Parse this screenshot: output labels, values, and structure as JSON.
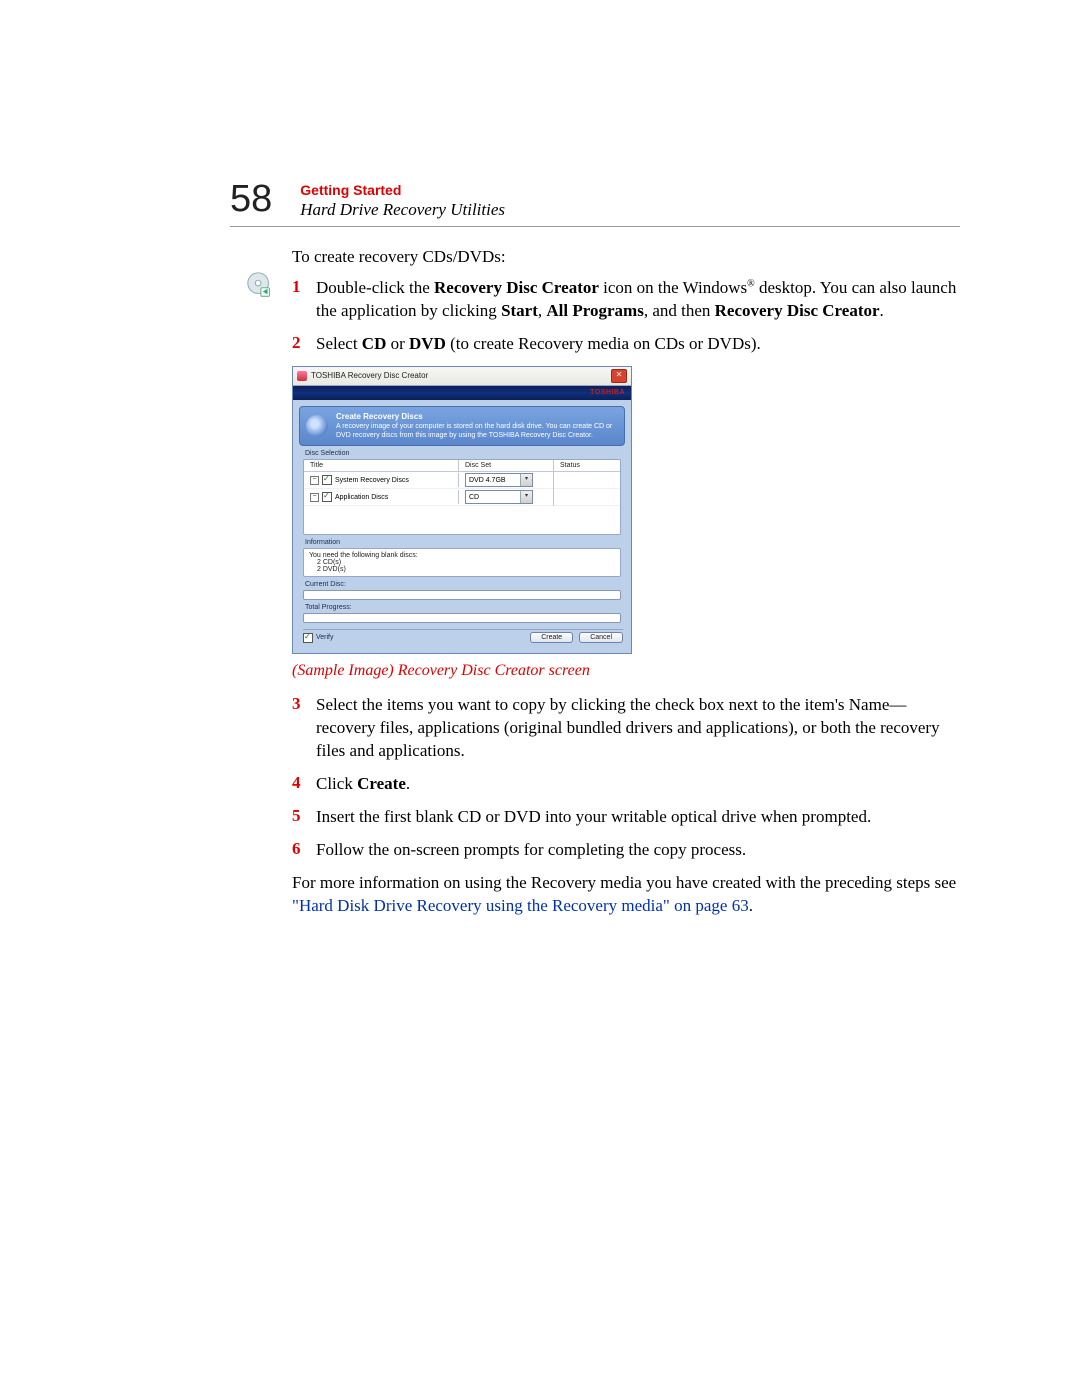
{
  "page_number": "58",
  "section_title": "Getting Started",
  "subtitle": "Hard Drive Recovery Utilities",
  "intro": "To create recovery CDs/DVDs:",
  "steps": {
    "s1": {
      "num": "1",
      "pre": "Double-click the ",
      "b1": "Recovery Disc Creator",
      "mid1": " icon on the Windows",
      "sup": "®",
      "mid2": " desktop. You can also launch the application by clicking ",
      "b2": "Start",
      "c1": ", ",
      "b3": "All Programs",
      "c2": ", and then ",
      "b4": "Recovery Disc Creator",
      "end": "."
    },
    "s2": {
      "num": "2",
      "pre": "Select ",
      "b1": "CD",
      "c1": " or ",
      "b2": "DVD",
      "end": " (to create Recovery media on CDs or DVDs)."
    },
    "s3": {
      "num": "3",
      "text": "Select the items you want to copy by clicking the check box next to the item's Name—recovery files, applications (original bundled drivers and applications), or both the recovery files and applications."
    },
    "s4": {
      "num": "4",
      "pre": "Click ",
      "b1": "Create",
      "end": "."
    },
    "s5": {
      "num": "5",
      "text": "Insert the first blank CD or DVD into your writable optical drive when prompted."
    },
    "s6": {
      "num": "6",
      "text": "Follow the on-screen prompts for completing the copy process."
    }
  },
  "caption": "(Sample Image) Recovery Disc Creator screen",
  "footer": {
    "pre": "For more information on using the Recovery media you have created with the preceding steps see ",
    "link": "\"Hard Disk Drive Recovery using the Recovery media\" on page 63",
    "end": "."
  },
  "dialog": {
    "title": "TOSHIBA Recovery Disc Creator",
    "close_glyph": "✕",
    "brand": "TOSHIBA",
    "banner_title": "Create Recovery Discs",
    "banner_desc": "A recovery image of your computer is stored on the hard disk drive. You can create CD or DVD recovery discs from this image by using the TOSHIBA Recovery Disc Creator.",
    "disc_selection": "Disc Selection",
    "col_title": "Title",
    "col_set": "Disc Set",
    "col_status": "Status",
    "rows": [
      {
        "label": "System Recovery Discs",
        "set": "DVD 4.7GB"
      },
      {
        "label": "Application Discs",
        "set": "CD"
      }
    ],
    "dropdown_glyph": "▾",
    "tree_glyph": "−",
    "information": "Information",
    "info_line1": "You need the following blank discs:",
    "info_line2": "2 CD(s)",
    "info_line3": "2 DVD(s)",
    "current_disc": "Current Disc:",
    "total_progress": "Total Progress:",
    "verify": "Verify",
    "create_btn": "Create",
    "cancel_btn": "Cancel"
  }
}
